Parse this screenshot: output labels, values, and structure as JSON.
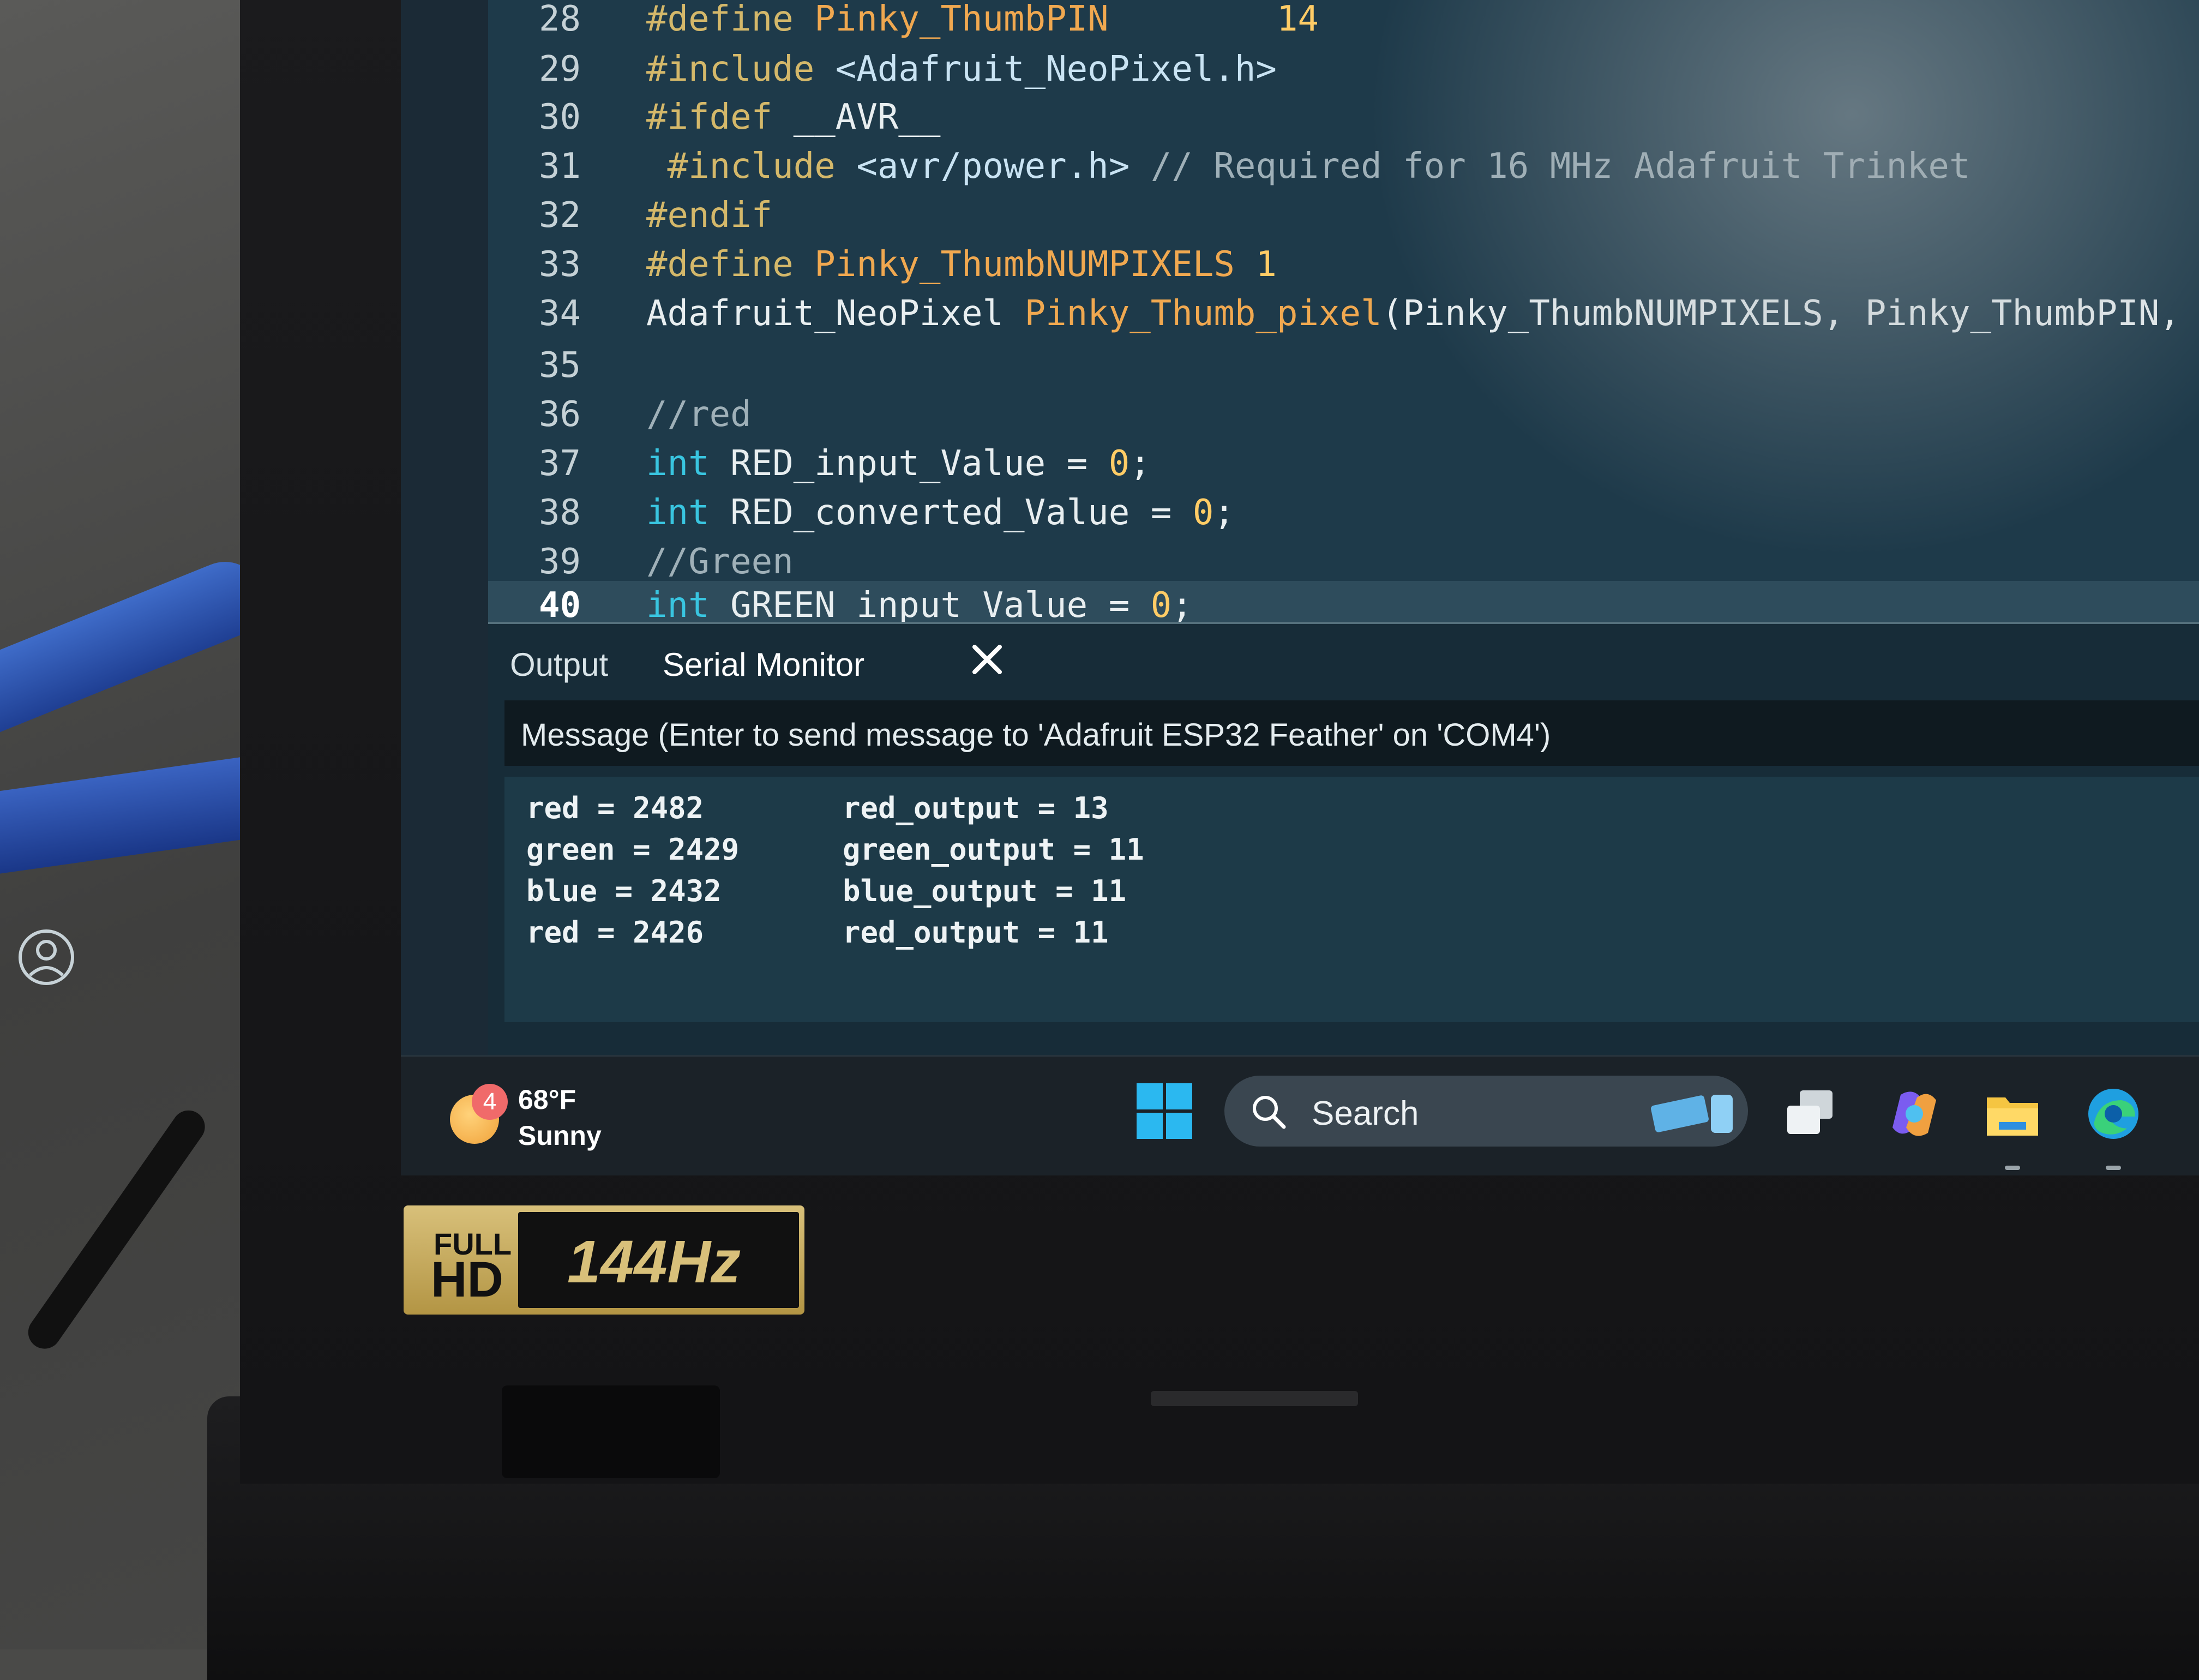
{
  "editor": {
    "lines": [
      {
        "num": "28",
        "parts": [
          {
            "t": "#define ",
            "c": "kw"
          },
          {
            "t": "Pinky_ThumbPIN",
            "c": "name"
          },
          {
            "t": "        14",
            "c": "num"
          }
        ]
      },
      {
        "num": "29",
        "parts": [
          {
            "t": "#include ",
            "c": "kw"
          },
          {
            "t": "<Adafruit_NeoPixel.h>",
            "c": "str"
          }
        ]
      },
      {
        "num": "30",
        "parts": [
          {
            "t": "#ifdef ",
            "c": "kw"
          },
          {
            "t": "__AVR__",
            "c": "plain"
          }
        ]
      },
      {
        "num": "31",
        "parts": [
          {
            "t": " #include ",
            "c": "kw"
          },
          {
            "t": "<avr/power.h>",
            "c": "str"
          },
          {
            "t": " // Required for 16 MHz Adafruit Trinket",
            "c": "cmt"
          }
        ]
      },
      {
        "num": "32",
        "parts": [
          {
            "t": "#endif",
            "c": "kw"
          }
        ]
      },
      {
        "num": "33",
        "parts": [
          {
            "t": "#define ",
            "c": "kw"
          },
          {
            "t": "Pinky_ThumbNUMPIXELS",
            "c": "name"
          },
          {
            "t": " 1",
            "c": "num"
          }
        ]
      },
      {
        "num": "34",
        "parts": [
          {
            "t": "Adafruit_NeoPixel ",
            "c": "plain"
          },
          {
            "t": "Pinky_Thumb_pixel",
            "c": "name"
          },
          {
            "t": "(Pinky_ThumbNUMPIXELS, Pinky_ThumbPIN, NEO_GR",
            "c": "plain"
          }
        ]
      },
      {
        "num": "35",
        "parts": []
      },
      {
        "num": "36",
        "parts": [
          {
            "t": "//red",
            "c": "cmt"
          }
        ]
      },
      {
        "num": "37",
        "parts": [
          {
            "t": "int ",
            "c": "type"
          },
          {
            "t": "RED_input_Value = ",
            "c": "plain"
          },
          {
            "t": "0",
            "c": "num"
          },
          {
            "t": ";",
            "c": "plain"
          }
        ]
      },
      {
        "num": "38",
        "parts": [
          {
            "t": "int ",
            "c": "type"
          },
          {
            "t": "RED_converted_Value = ",
            "c": "plain"
          },
          {
            "t": "0",
            "c": "num"
          },
          {
            "t": ";",
            "c": "plain"
          }
        ]
      },
      {
        "num": "39",
        "parts": [
          {
            "t": "//Green",
            "c": "cmt"
          }
        ]
      },
      {
        "num": "40",
        "parts": [
          {
            "t": "int ",
            "c": "type"
          },
          {
            "t": "GREEN_input_Value = ",
            "c": "plain"
          },
          {
            "t": "0",
            "c": "num"
          },
          {
            "t": ";",
            "c": "plain"
          }
        ]
      }
    ],
    "current_line": "40"
  },
  "panel": {
    "tab_output": "Output",
    "tab_serial": "Serial Monitor",
    "message_placeholder": "Message (Enter to send message to 'Adafruit ESP32 Feather' on 'COM4')",
    "serial_lines": [
      {
        "left": "red = 2482",
        "right": "red_output = 13"
      },
      {
        "left": "green = 2429",
        "right": "green_output = 11"
      },
      {
        "left": "blue = 2432",
        "right": "blue_output = 11"
      },
      {
        "left": "red = 2426",
        "right": "red_output = 11"
      }
    ]
  },
  "taskbar": {
    "weather_badge": "4",
    "weather_temp": "68°F",
    "weather_condition": "Sunny",
    "search_label": "Search",
    "icons": [
      "windows-start-icon",
      "search-icon",
      "task-view-icon",
      "copilot-icon",
      "file-explorer-icon",
      "edge-icon"
    ]
  },
  "sticker": {
    "line1": "FULL",
    "line2": "HD",
    "rate": "144Hz"
  },
  "colors": {
    "editor_bg": "#1e3a4a",
    "keyword": "#d4b86a",
    "identifier": "#f0a850",
    "type": "#39c5e0",
    "comment": "#9fb0b8",
    "taskbar_bg": "#1b2228"
  }
}
